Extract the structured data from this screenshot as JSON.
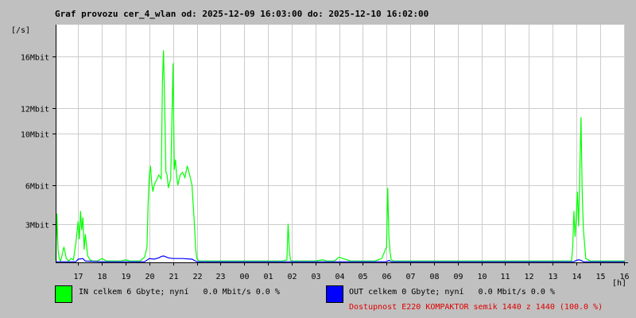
{
  "title": "Graf provozu cer_4_wlan od: 2025-12-09 16:03:00 do: 2025-12-10 16:02:00",
  "legend": {
    "in_label": "IN celkem 6 Gbyte; nyní   0.0 Mbit/s 0.0 %",
    "out_label": "OUT celkem 0 Gbyte; nyní   0.0 Mbit/s 0.0 %",
    "in_color": "#00ff00",
    "out_color": "#0000ff"
  },
  "availability": "Dostupnost E220 KOMPAKTOR semik 1440 z 1440 (100.0 %)",
  "chart_data": {
    "type": "line",
    "ylabel": "[/s]",
    "xlabel": "[h]",
    "xlim": [
      16.05,
      16.05
    ],
    "ylim": [
      0,
      18.5
    ],
    "grid": true,
    "x_ticks": [
      "17",
      "18",
      "19",
      "20",
      "21",
      "22",
      "23",
      "00",
      "01",
      "02",
      "03",
      "04",
      "05",
      "06",
      "07",
      "08",
      "09",
      "10",
      "11",
      "12",
      "13",
      "14",
      "15",
      "16"
    ],
    "y_ticks": [
      {
        "label": "3Mbit",
        "value": 3
      },
      {
        "label": "6Mbit",
        "value": 6
      },
      {
        "label": "10Mbit",
        "value": 10
      },
      {
        "label": "12Mbit",
        "value": 12
      },
      {
        "label": "16Mbit",
        "value": 16
      }
    ],
    "series": [
      {
        "name": "IN",
        "color": "#00ff00",
        "x": [
          16.05,
          16.1,
          16.15,
          16.2,
          16.25,
          16.3,
          16.4,
          16.5,
          16.6,
          16.7,
          16.8,
          16.9,
          17.0,
          17.05,
          17.1,
          17.15,
          17.2,
          17.25,
          17.3,
          17.4,
          17.5,
          17.6,
          17.8,
          18.0,
          18.2,
          18.4,
          18.6,
          18.8,
          19.0,
          19.2,
          19.4,
          19.6,
          19.8,
          19.9,
          19.95,
          20.0,
          20.05,
          20.1,
          20.15,
          20.2,
          20.3,
          20.4,
          20.5,
          20.55,
          20.6,
          20.65,
          20.7,
          20.75,
          20.8,
          20.9,
          21.0,
          21.05,
          21.1,
          21.15,
          21.2,
          21.3,
          21.4,
          21.5,
          21.6,
          21.7,
          21.8,
          21.9,
          21.95,
          22.0,
          22.1,
          22.3,
          22.6,
          23.0,
          23.5,
          0.0,
          0.5,
          1.0,
          1.4,
          1.6,
          1.8,
          1.85,
          1.9,
          1.95,
          2.0,
          2.2,
          2.5,
          3.0,
          3.3,
          3.5,
          3.8,
          4.0,
          4.5,
          5.0,
          5.5,
          5.8,
          6.0,
          6.05,
          6.1,
          6.15,
          6.2,
          6.3,
          6.5,
          7.0,
          8.0,
          9.0,
          10.0,
          11.0,
          12.0,
          13.0,
          13.5,
          13.8,
          13.85,
          13.9,
          13.95,
          14.0,
          14.05,
          14.1,
          14.15,
          14.2,
          14.25,
          14.3,
          14.4,
          14.6,
          15.0,
          15.5,
          16.0,
          16.05
        ],
        "values": [
          0.2,
          3.8,
          1.0,
          0.3,
          0.1,
          0.4,
          1.2,
          0.3,
          0.1,
          0.3,
          0.2,
          1.5,
          3.2,
          1.8,
          4.0,
          2.5,
          3.5,
          1.0,
          2.2,
          0.5,
          0.2,
          0.1,
          0.1,
          0.3,
          0.1,
          0.1,
          0.1,
          0.1,
          0.2,
          0.1,
          0.1,
          0.1,
          0.4,
          1.2,
          4.5,
          6.8,
          7.5,
          6.2,
          5.5,
          6.0,
          6.4,
          6.8,
          6.5,
          14.0,
          16.5,
          12.0,
          7.0,
          6.8,
          5.8,
          6.5,
          15.5,
          7.2,
          8.0,
          6.8,
          6.0,
          6.8,
          7.0,
          6.6,
          7.5,
          6.8,
          6.0,
          3.0,
          1.2,
          0.3,
          0.1,
          0.1,
          0.1,
          0.1,
          0.1,
          0.1,
          0.1,
          0.1,
          0.1,
          0.1,
          0.2,
          3.0,
          1.0,
          0.2,
          0.1,
          0.1,
          0.1,
          0.1,
          0.2,
          0.1,
          0.1,
          0.4,
          0.1,
          0.1,
          0.1,
          0.3,
          1.2,
          5.8,
          2.0,
          0.8,
          0.2,
          0.1,
          0.1,
          0.1,
          0.1,
          0.1,
          0.1,
          0.1,
          0.1,
          0.1,
          0.1,
          0.1,
          1.2,
          4.0,
          2.0,
          3.5,
          5.5,
          2.8,
          7.0,
          11.3,
          5.5,
          2.6,
          0.3,
          0.1,
          0.1,
          0.1,
          0.1,
          0.1
        ]
      },
      {
        "name": "OUT",
        "color": "#0000ff",
        "x": [
          16.05,
          16.9,
          17.0,
          17.2,
          17.3,
          18.0,
          19.8,
          20.0,
          20.2,
          20.4,
          20.5,
          20.6,
          20.8,
          21.0,
          21.4,
          21.8,
          22.0,
          23.0,
          6.0,
          6.1,
          6.2,
          13.9,
          14.0,
          14.1,
          14.2,
          14.3,
          16.05
        ],
        "values": [
          0.05,
          0.05,
          0.25,
          0.3,
          0.1,
          0.05,
          0.05,
          0.3,
          0.25,
          0.35,
          0.45,
          0.5,
          0.35,
          0.3,
          0.3,
          0.25,
          0.05,
          0.05,
          0.05,
          0.15,
          0.05,
          0.05,
          0.15,
          0.2,
          0.15,
          0.05,
          0.05
        ]
      }
    ]
  }
}
